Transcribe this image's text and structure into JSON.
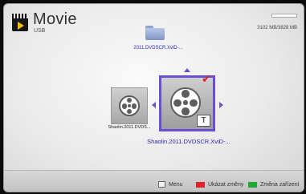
{
  "header": {
    "title": "Movie",
    "subtitle": "USB",
    "storage": "3102 MB/3828 MB",
    "icon": "film-icon"
  },
  "folder": {
    "label": "2011.DVDSCR.XviD-...",
    "icon": "folder-icon"
  },
  "files": [
    {
      "label": "Shaolin.2011.DVDS...",
      "icon": "film-reel-icon"
    },
    {
      "label": "Shaolin.2011.DVDSCR.XviD-...",
      "icon": "film-reel-icon",
      "selected": true,
      "badge": "T",
      "checked": true
    }
  ],
  "legend": [
    {
      "label": "Menu",
      "icon": "menu-icon"
    },
    {
      "label": "Ukázat změny",
      "color": "#e0242a"
    },
    {
      "label": "Změna zařízení",
      "color": "#1ea83a"
    }
  ],
  "colors": {
    "accent": "#6a4fd0",
    "label": "#2a22b8",
    "check": "#d82222"
  }
}
